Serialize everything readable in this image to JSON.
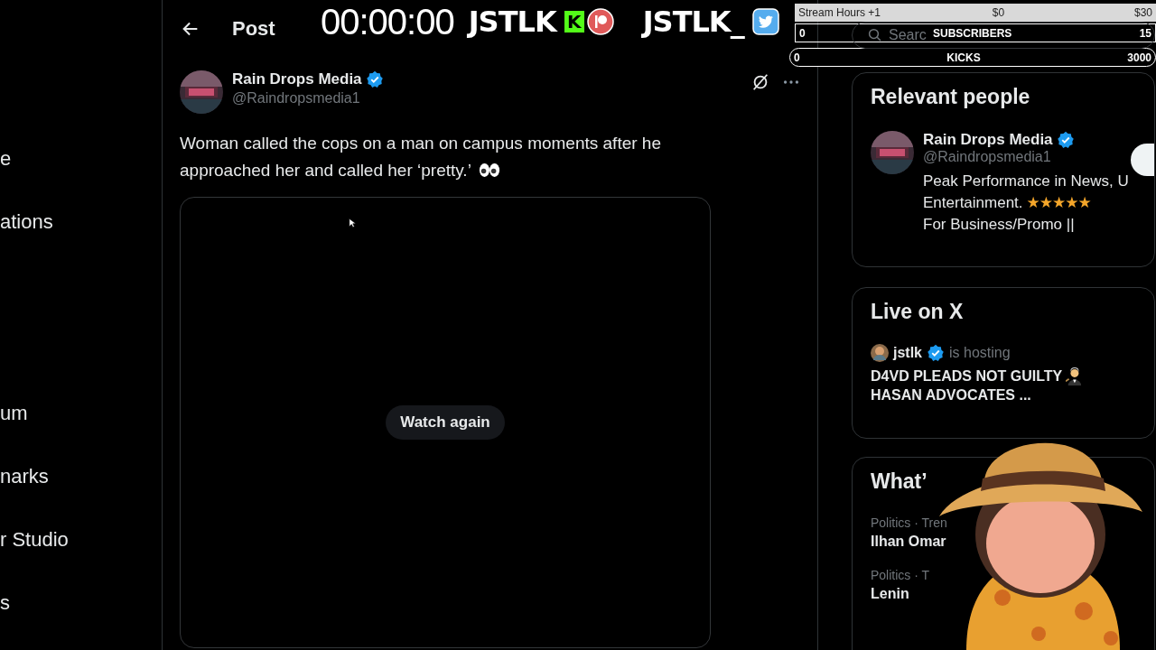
{
  "overlay": {
    "timer": "00:00:00",
    "logos": [
      {
        "kind": "kick",
        "text": "JSTLK",
        "badge": "K"
      },
      {
        "kind": "twitter",
        "text": "JSTLK_"
      }
    ],
    "goals": [
      {
        "kind": "light",
        "label": "Stream Hours +1",
        "start": "$0",
        "end": "$30"
      },
      {
        "kind": "box",
        "label": "SUBSCRIBERS",
        "start": "0",
        "end": "15"
      },
      {
        "kind": "pill",
        "label": "KICKS",
        "start": "0",
        "end": "3000"
      }
    ]
  },
  "sidebar": {
    "items": [
      "e",
      "ations",
      "um",
      "narks",
      "r Studio",
      "s"
    ]
  },
  "header": {
    "title": "Post"
  },
  "post": {
    "author": {
      "name": "Rain Drops Media",
      "verified": true,
      "handle": "@Raindropsmedia1"
    },
    "text": "Woman called the cops on a man on campus moments after he approached her and called her ‘pretty.’",
    "video": {
      "button": "Watch again"
    }
  },
  "search": {
    "placeholder": "Searc"
  },
  "relevant_people": {
    "title": "Relevant people",
    "person": {
      "name": "Rain Drops Media",
      "verified": true,
      "handle": "@Raindropsmedia1",
      "bio": [
        {
          "text": "Peak Performance in News, U"
        },
        {
          "text": "Entertainment.",
          "stars": "★★★★★"
        },
        {
          "text": "For Business/Promo ||"
        }
      ]
    }
  },
  "live": {
    "title": "Live on X",
    "host": "jstlk",
    "verified": true,
    "status": "is hosting",
    "lines": [
      "D4VD PLEADS NOT GUILTY",
      "HASAN ADVOCATES ..."
    ]
  },
  "trending": {
    "title": "What’",
    "items": [
      {
        "meta": "Politics · Tren",
        "name": "Ilhan Omar"
      },
      {
        "meta": "Politics · T",
        "name": "Lenin"
      }
    ]
  }
}
